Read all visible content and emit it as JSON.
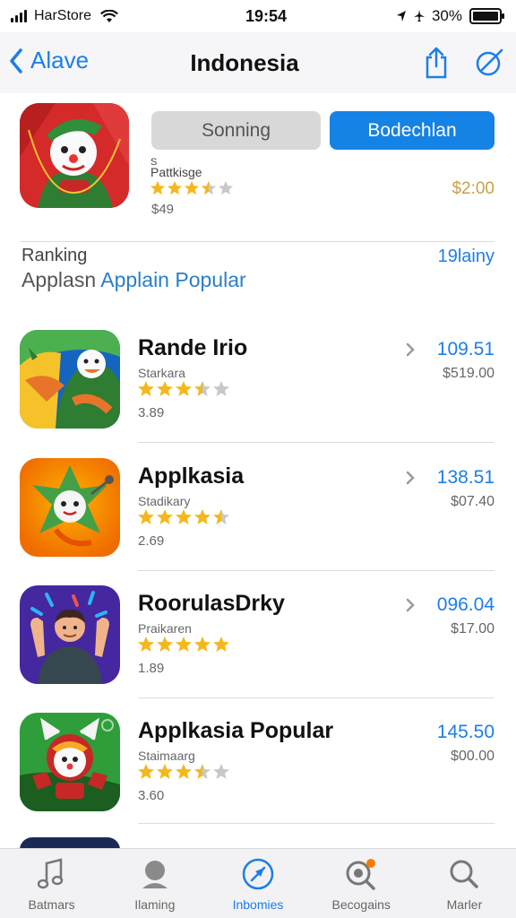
{
  "status_bar": {
    "carrier": "HarStore",
    "time": "19:54",
    "battery": "30%"
  },
  "nav": {
    "back_label": "Alave",
    "title": "Indonesia"
  },
  "featured": {
    "segment_grey": "Sonning",
    "segment_blue": "Bodechlan",
    "small_label_1": "S",
    "small_label_2": "Pattkisge",
    "rating": 3.5,
    "subtext": "$49",
    "price": "$2:00"
  },
  "ranking": {
    "label": "Ranking",
    "link": "19lainy",
    "title_plain": "Applasn",
    "title_blue": "Applain Popular"
  },
  "apps": [
    {
      "name": "Rande Irio",
      "sub": "Starkara",
      "rating": 3.5,
      "count": "3.89",
      "price": "109.51",
      "price2": "$519.00",
      "chevron": true
    },
    {
      "name": "Applkasia",
      "sub": "Stadikary",
      "rating": 4.5,
      "count": "2.69",
      "price": "138.51",
      "price2": "$07.40",
      "chevron": true
    },
    {
      "name": "RoorulasDrky",
      "sub": "Praikaren",
      "rating": 5,
      "count": "1.89",
      "price": "096.04",
      "price2": "$17.00",
      "chevron": true
    },
    {
      "name": "Applkasia Popular",
      "sub": "Staimaarg",
      "rating": 3.5,
      "count": "3.60",
      "price": "145.50",
      "price2": "$00.00",
      "chevron": false
    }
  ],
  "tabs": [
    {
      "label": "Batmars",
      "icon": "music-note-icon"
    },
    {
      "label": "Ilaming",
      "icon": "person-icon"
    },
    {
      "label": "Inbomies",
      "icon": "compass-icon",
      "active": true
    },
    {
      "label": "Becogains",
      "icon": "search-badge-icon"
    },
    {
      "label": "Marler",
      "icon": "search-icon"
    }
  ],
  "colors": {
    "accent": "#1c7ee8",
    "star": "#f4b81c",
    "star_empty": "#c8c8c8"
  }
}
